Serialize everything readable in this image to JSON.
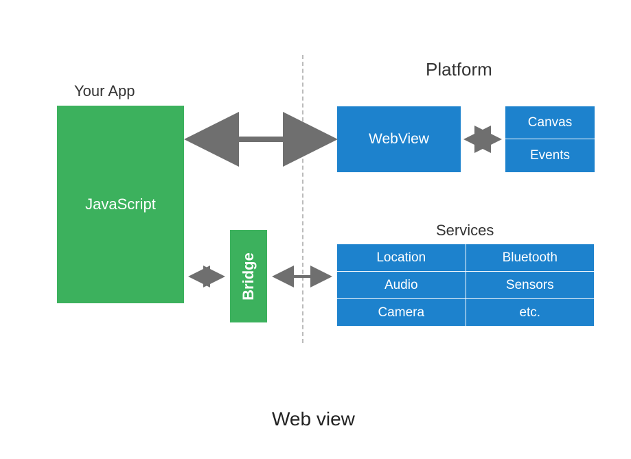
{
  "labels": {
    "your_app": "Your App",
    "platform": "Platform",
    "services": "Services",
    "caption": "Web view"
  },
  "boxes": {
    "javascript": "JavaScript",
    "bridge": "Bridge",
    "webview": "WebView",
    "canvas": "Canvas",
    "events": "Events"
  },
  "services": {
    "rows": [
      [
        "Location",
        "Bluetooth"
      ],
      [
        "Audio",
        "Sensors"
      ],
      [
        "Camera",
        "etc."
      ]
    ]
  },
  "colors": {
    "green": "#3cb15d",
    "blue": "#1d82cd",
    "arrow": "#6f6f6f"
  }
}
